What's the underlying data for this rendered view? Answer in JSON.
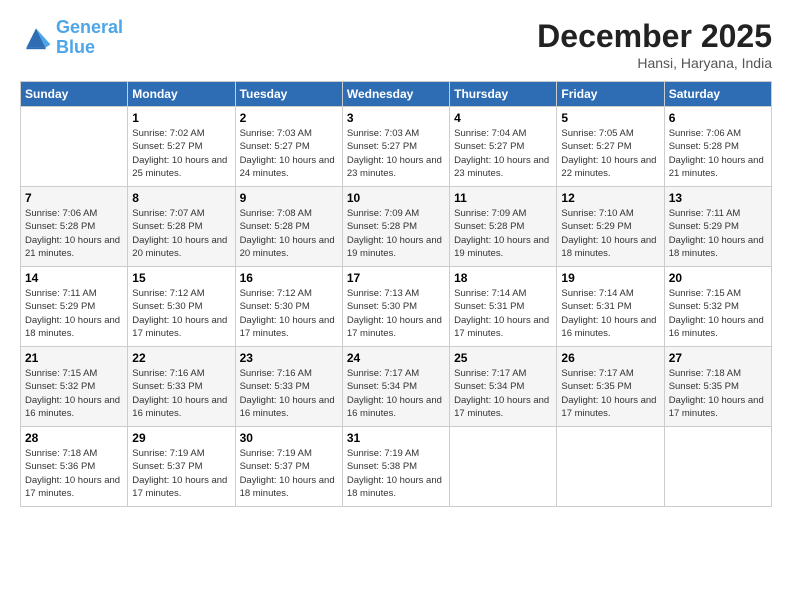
{
  "header": {
    "logo_line1": "General",
    "logo_line2": "Blue",
    "month": "December 2025",
    "location": "Hansi, Haryana, India"
  },
  "days_of_week": [
    "Sunday",
    "Monday",
    "Tuesday",
    "Wednesday",
    "Thursday",
    "Friday",
    "Saturday"
  ],
  "weeks": [
    [
      {
        "num": "",
        "sunrise": "",
        "sunset": "",
        "daylight": ""
      },
      {
        "num": "1",
        "sunrise": "Sunrise: 7:02 AM",
        "sunset": "Sunset: 5:27 PM",
        "daylight": "Daylight: 10 hours and 25 minutes."
      },
      {
        "num": "2",
        "sunrise": "Sunrise: 7:03 AM",
        "sunset": "Sunset: 5:27 PM",
        "daylight": "Daylight: 10 hours and 24 minutes."
      },
      {
        "num": "3",
        "sunrise": "Sunrise: 7:03 AM",
        "sunset": "Sunset: 5:27 PM",
        "daylight": "Daylight: 10 hours and 23 minutes."
      },
      {
        "num": "4",
        "sunrise": "Sunrise: 7:04 AM",
        "sunset": "Sunset: 5:27 PM",
        "daylight": "Daylight: 10 hours and 23 minutes."
      },
      {
        "num": "5",
        "sunrise": "Sunrise: 7:05 AM",
        "sunset": "Sunset: 5:27 PM",
        "daylight": "Daylight: 10 hours and 22 minutes."
      },
      {
        "num": "6",
        "sunrise": "Sunrise: 7:06 AM",
        "sunset": "Sunset: 5:28 PM",
        "daylight": "Daylight: 10 hours and 21 minutes."
      }
    ],
    [
      {
        "num": "7",
        "sunrise": "Sunrise: 7:06 AM",
        "sunset": "Sunset: 5:28 PM",
        "daylight": "Daylight: 10 hours and 21 minutes."
      },
      {
        "num": "8",
        "sunrise": "Sunrise: 7:07 AM",
        "sunset": "Sunset: 5:28 PM",
        "daylight": "Daylight: 10 hours and 20 minutes."
      },
      {
        "num": "9",
        "sunrise": "Sunrise: 7:08 AM",
        "sunset": "Sunset: 5:28 PM",
        "daylight": "Daylight: 10 hours and 20 minutes."
      },
      {
        "num": "10",
        "sunrise": "Sunrise: 7:09 AM",
        "sunset": "Sunset: 5:28 PM",
        "daylight": "Daylight: 10 hours and 19 minutes."
      },
      {
        "num": "11",
        "sunrise": "Sunrise: 7:09 AM",
        "sunset": "Sunset: 5:28 PM",
        "daylight": "Daylight: 10 hours and 19 minutes."
      },
      {
        "num": "12",
        "sunrise": "Sunrise: 7:10 AM",
        "sunset": "Sunset: 5:29 PM",
        "daylight": "Daylight: 10 hours and 18 minutes."
      },
      {
        "num": "13",
        "sunrise": "Sunrise: 7:11 AM",
        "sunset": "Sunset: 5:29 PM",
        "daylight": "Daylight: 10 hours and 18 minutes."
      }
    ],
    [
      {
        "num": "14",
        "sunrise": "Sunrise: 7:11 AM",
        "sunset": "Sunset: 5:29 PM",
        "daylight": "Daylight: 10 hours and 18 minutes."
      },
      {
        "num": "15",
        "sunrise": "Sunrise: 7:12 AM",
        "sunset": "Sunset: 5:30 PM",
        "daylight": "Daylight: 10 hours and 17 minutes."
      },
      {
        "num": "16",
        "sunrise": "Sunrise: 7:12 AM",
        "sunset": "Sunset: 5:30 PM",
        "daylight": "Daylight: 10 hours and 17 minutes."
      },
      {
        "num": "17",
        "sunrise": "Sunrise: 7:13 AM",
        "sunset": "Sunset: 5:30 PM",
        "daylight": "Daylight: 10 hours and 17 minutes."
      },
      {
        "num": "18",
        "sunrise": "Sunrise: 7:14 AM",
        "sunset": "Sunset: 5:31 PM",
        "daylight": "Daylight: 10 hours and 17 minutes."
      },
      {
        "num": "19",
        "sunrise": "Sunrise: 7:14 AM",
        "sunset": "Sunset: 5:31 PM",
        "daylight": "Daylight: 10 hours and 16 minutes."
      },
      {
        "num": "20",
        "sunrise": "Sunrise: 7:15 AM",
        "sunset": "Sunset: 5:32 PM",
        "daylight": "Daylight: 10 hours and 16 minutes."
      }
    ],
    [
      {
        "num": "21",
        "sunrise": "Sunrise: 7:15 AM",
        "sunset": "Sunset: 5:32 PM",
        "daylight": "Daylight: 10 hours and 16 minutes."
      },
      {
        "num": "22",
        "sunrise": "Sunrise: 7:16 AM",
        "sunset": "Sunset: 5:33 PM",
        "daylight": "Daylight: 10 hours and 16 minutes."
      },
      {
        "num": "23",
        "sunrise": "Sunrise: 7:16 AM",
        "sunset": "Sunset: 5:33 PM",
        "daylight": "Daylight: 10 hours and 16 minutes."
      },
      {
        "num": "24",
        "sunrise": "Sunrise: 7:17 AM",
        "sunset": "Sunset: 5:34 PM",
        "daylight": "Daylight: 10 hours and 16 minutes."
      },
      {
        "num": "25",
        "sunrise": "Sunrise: 7:17 AM",
        "sunset": "Sunset: 5:34 PM",
        "daylight": "Daylight: 10 hours and 17 minutes."
      },
      {
        "num": "26",
        "sunrise": "Sunrise: 7:17 AM",
        "sunset": "Sunset: 5:35 PM",
        "daylight": "Daylight: 10 hours and 17 minutes."
      },
      {
        "num": "27",
        "sunrise": "Sunrise: 7:18 AM",
        "sunset": "Sunset: 5:35 PM",
        "daylight": "Daylight: 10 hours and 17 minutes."
      }
    ],
    [
      {
        "num": "28",
        "sunrise": "Sunrise: 7:18 AM",
        "sunset": "Sunset: 5:36 PM",
        "daylight": "Daylight: 10 hours and 17 minutes."
      },
      {
        "num": "29",
        "sunrise": "Sunrise: 7:19 AM",
        "sunset": "Sunset: 5:37 PM",
        "daylight": "Daylight: 10 hours and 17 minutes."
      },
      {
        "num": "30",
        "sunrise": "Sunrise: 7:19 AM",
        "sunset": "Sunset: 5:37 PM",
        "daylight": "Daylight: 10 hours and 18 minutes."
      },
      {
        "num": "31",
        "sunrise": "Sunrise: 7:19 AM",
        "sunset": "Sunset: 5:38 PM",
        "daylight": "Daylight: 10 hours and 18 minutes."
      },
      {
        "num": "",
        "sunrise": "",
        "sunset": "",
        "daylight": ""
      },
      {
        "num": "",
        "sunrise": "",
        "sunset": "",
        "daylight": ""
      },
      {
        "num": "",
        "sunrise": "",
        "sunset": "",
        "daylight": ""
      }
    ]
  ]
}
